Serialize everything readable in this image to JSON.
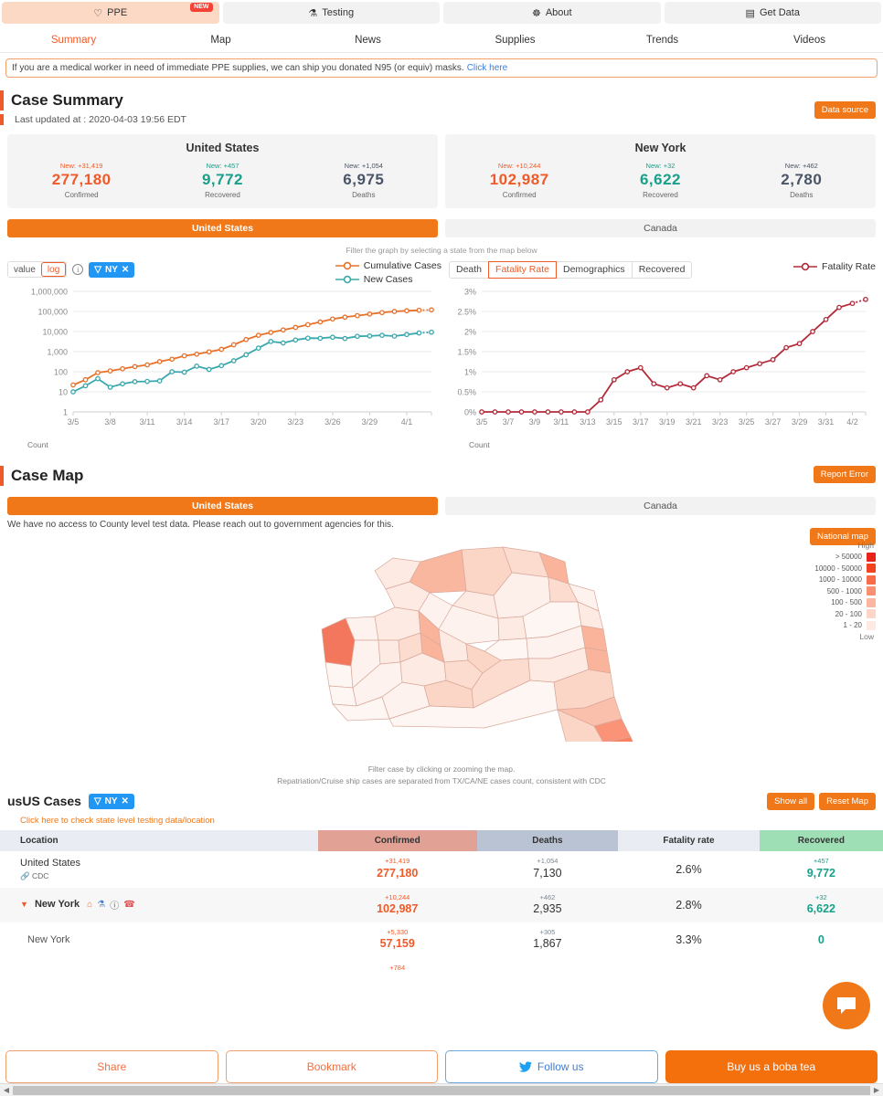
{
  "top_tabs": [
    {
      "label": "PPE",
      "icon": "heart-icon",
      "glyph": "♡",
      "active": true,
      "badge": "NEW"
    },
    {
      "label": "Testing",
      "icon": "flask-icon",
      "glyph": "⚗",
      "active": false,
      "badge": ""
    },
    {
      "label": "About",
      "icon": "person-icon",
      "glyph": "Ք",
      "active": false,
      "badge": ""
    },
    {
      "label": "Get Data",
      "icon": "database-icon",
      "glyph": "☷",
      "active": false,
      "badge": ""
    }
  ],
  "subnav": [
    {
      "label": "Summary",
      "active": true
    },
    {
      "label": "Map",
      "active": false
    },
    {
      "label": "News",
      "active": false
    },
    {
      "label": "Supplies",
      "active": false
    },
    {
      "label": "Trends",
      "active": false
    },
    {
      "label": "Videos",
      "active": false
    }
  ],
  "banner": {
    "text": "If you are a medical worker in need of immediate PPE supplies, we can ship you donated N95 (or equiv) masks.",
    "link": "Click here"
  },
  "case_summary": {
    "title": "Case Summary",
    "updated": "Last updated at : 2020-04-03 19:56 EDT",
    "data_source_btn": "Data source",
    "cards": [
      {
        "title": "United States",
        "stats": [
          {
            "new": "New: +31,419",
            "value": "277,180",
            "label": "Confirmed",
            "kind": "confirmed"
          },
          {
            "new": "New: +457",
            "value": "9,772",
            "label": "Recovered",
            "kind": "recovered"
          },
          {
            "new": "New: +1,054",
            "value": "6,975",
            "label": "Deaths",
            "kind": "deaths"
          }
        ]
      },
      {
        "title": "New York",
        "stats": [
          {
            "new": "New: +10,244",
            "value": "102,987",
            "label": "Confirmed",
            "kind": "confirmed"
          },
          {
            "new": "New: +32",
            "value": "6,622",
            "label": "Recovered",
            "kind": "recovered"
          },
          {
            "new": "New: +462",
            "value": "2,780",
            "label": "Deaths",
            "kind": "deaths"
          }
        ]
      }
    ]
  },
  "country_toggle_1": [
    {
      "label": "United States",
      "active": true
    },
    {
      "label": "Canada",
      "active": false
    }
  ],
  "filter_hint": "Filter the graph by selecting a state from the map below",
  "left_chart_controls": {
    "scale_options": [
      "value",
      "log"
    ],
    "scale_selected": "log",
    "info_icon": "info-icon",
    "filter_chip": "NY"
  },
  "right_chart_tabs": [
    {
      "label": "Death",
      "active": false
    },
    {
      "label": "Fatality Rate",
      "active": true
    },
    {
      "label": "Demographics",
      "active": false
    },
    {
      "label": "Recovered",
      "active": false
    }
  ],
  "case_map": {
    "title": "Case Map",
    "report_error_btn": "Report Error",
    "national_map_btn": "National map",
    "note": "We have no access to County level test data. Please reach out to government agencies for this.",
    "caption_1": "Filter case by clicking or zooming the map.",
    "caption_2": "Repatriation/Cruise ship cases are separated from TX/CA/NE cases count, consistent with CDC",
    "legend_high": "High",
    "legend_low": "Low",
    "legend_items": [
      {
        "label": "> 50000",
        "color": "#e8231a"
      },
      {
        "label": "10000 - 50000",
        "color": "#f4431f"
      },
      {
        "label": "1000 - 10000",
        "color": "#f86c4a"
      },
      {
        "label": "500 - 1000",
        "color": "#fa8f72"
      },
      {
        "label": "100 - 500",
        "color": "#fcb5a0"
      },
      {
        "label": "20 - 100",
        "color": "#fdd6c8"
      },
      {
        "label": "1 - 20",
        "color": "#feeae3"
      }
    ]
  },
  "country_toggle_2": [
    {
      "label": "United States",
      "active": true
    },
    {
      "label": "Canada",
      "active": false
    }
  ],
  "us_cases": {
    "title": "usUS Cases",
    "filter_chip": "NY",
    "show_all_btn": "Show all",
    "reset_map_btn": "Reset Map",
    "state_link": "Click here to check state level testing data/location",
    "columns": [
      "Location",
      "Confirmed",
      "Deaths",
      "Fatality rate",
      "Recovered"
    ],
    "rows": [
      {
        "location": "United States",
        "source": "CDC",
        "icons": [],
        "indent": false,
        "confirmed_delta": "+31,419",
        "confirmed": "277,180",
        "deaths_delta": "+1,054",
        "deaths": "7,130",
        "fatality": "2.6%",
        "recovered_delta": "+457",
        "recovered": "9,772"
      },
      {
        "location": "New York",
        "source": "",
        "icons": [
          "caret-down-icon",
          "home-icon",
          "flask-icon",
          "info-icon",
          "phone-icon"
        ],
        "indent": false,
        "confirmed_delta": "+10,244",
        "confirmed": "102,987",
        "deaths_delta": "+462",
        "deaths": "2,935",
        "fatality": "2.8%",
        "recovered_delta": "+32",
        "recovered": "6,622"
      },
      {
        "location": "New York",
        "source": "",
        "icons": [],
        "indent": true,
        "confirmed_delta": "+5,330",
        "confirmed": "57,159",
        "deaths_delta": "+305",
        "deaths": "1,867",
        "fatality": "3.3%",
        "recovered_delta": "",
        "recovered": "0"
      }
    ],
    "partial_row_delta": "+784"
  },
  "chat_widget": {
    "icon": "chat-bubble-icon",
    "color": "#f07818"
  },
  "footer": [
    {
      "label": "Share",
      "style": "share"
    },
    {
      "label": "Bookmark",
      "style": "bookmark"
    },
    {
      "label": "Follow us",
      "style": "follow",
      "icon": "twitter-icon"
    },
    {
      "label": "Buy us a boba tea",
      "style": "boba"
    }
  ],
  "chart_data": [
    {
      "type": "line",
      "title": "",
      "chart_id": "cumulative-new-cases",
      "scale": "log",
      "xlabel": "Count",
      "ylabel": "",
      "ylim": [
        1,
        1000000
      ],
      "ytick_labels": [
        "1,000,000",
        "100,000",
        "10,000",
        "1,000",
        "100",
        "10",
        "1"
      ],
      "ytick_values": [
        1000000,
        100000,
        10000,
        1000,
        100,
        10,
        1
      ],
      "xtick_labels": [
        "3/5",
        "3/8",
        "3/11",
        "3/14",
        "3/17",
        "3/20",
        "3/23",
        "3/26",
        "3/29",
        "4/1"
      ],
      "grid": true,
      "legend_position": "top-right",
      "x": [
        "3/5",
        "3/6",
        "3/7",
        "3/8",
        "3/9",
        "3/10",
        "3/11",
        "3/12",
        "3/13",
        "3/14",
        "3/15",
        "3/16",
        "3/17",
        "3/18",
        "3/19",
        "3/20",
        "3/21",
        "3/22",
        "3/23",
        "3/24",
        "3/25",
        "3/26",
        "3/27",
        "3/28",
        "3/29",
        "3/30",
        "3/31",
        "4/1",
        "4/2",
        "4/3"
      ],
      "series": [
        {
          "name": "Cumulative Cases",
          "color": "#e8712a",
          "values": [
            22,
            40,
            90,
            110,
            140,
            180,
            220,
            320,
            420,
            620,
            750,
            980,
            1300,
            2200,
            4000,
            6500,
            9000,
            12000,
            16000,
            22000,
            30000,
            42000,
            52000,
            62000,
            74000,
            88000,
            100000,
            108000,
            115000,
            120000
          ]
        },
        {
          "name": "New Cases",
          "color": "#3aa8ad",
          "values": [
            10,
            20,
            45,
            17,
            25,
            32,
            33,
            35,
            100,
            95,
            190,
            130,
            200,
            350,
            700,
            1500,
            3200,
            2700,
            3800,
            4700,
            4600,
            5200,
            4500,
            5800,
            6000,
            6500,
            5900,
            7100,
            8500,
            9300
          ]
        }
      ]
    },
    {
      "type": "line",
      "title": "",
      "chart_id": "fatality-rate",
      "scale": "linear",
      "xlabel": "Count",
      "ylabel": "",
      "ylim": [
        0,
        3
      ],
      "ytick_labels": [
        "3%",
        "2.5%",
        "2%",
        "1.5%",
        "1%",
        "0.5%",
        "0%"
      ],
      "ytick_values": [
        3,
        2.5,
        2,
        1.5,
        1,
        0.5,
        0
      ],
      "xtick_labels": [
        "3/5",
        "3/7",
        "3/9",
        "3/11",
        "3/13",
        "3/15",
        "3/17",
        "3/19",
        "3/21",
        "3/23",
        "3/25",
        "3/27",
        "3/29",
        "3/31",
        "4/2"
      ],
      "grid": true,
      "legend_position": "top-right",
      "x": [
        "3/5",
        "3/6",
        "3/7",
        "3/8",
        "3/9",
        "3/10",
        "3/11",
        "3/12",
        "3/13",
        "3/14",
        "3/15",
        "3/16",
        "3/17",
        "3/18",
        "3/19",
        "3/20",
        "3/21",
        "3/22",
        "3/23",
        "3/24",
        "3/25",
        "3/26",
        "3/27",
        "3/28",
        "3/29",
        "3/30",
        "3/31",
        "4/1",
        "4/2",
        "4/3"
      ],
      "series": [
        {
          "name": "Fatality Rate",
          "color": "#b32b3a",
          "values": [
            0,
            0,
            0,
            0,
            0,
            0,
            0,
            0,
            0,
            0.3,
            0.8,
            1.0,
            1.1,
            0.7,
            0.6,
            0.7,
            0.6,
            0.9,
            0.8,
            1.0,
            1.1,
            1.2,
            1.3,
            1.6,
            1.7,
            2.0,
            2.3,
            2.6,
            2.7,
            2.8
          ]
        }
      ]
    }
  ]
}
